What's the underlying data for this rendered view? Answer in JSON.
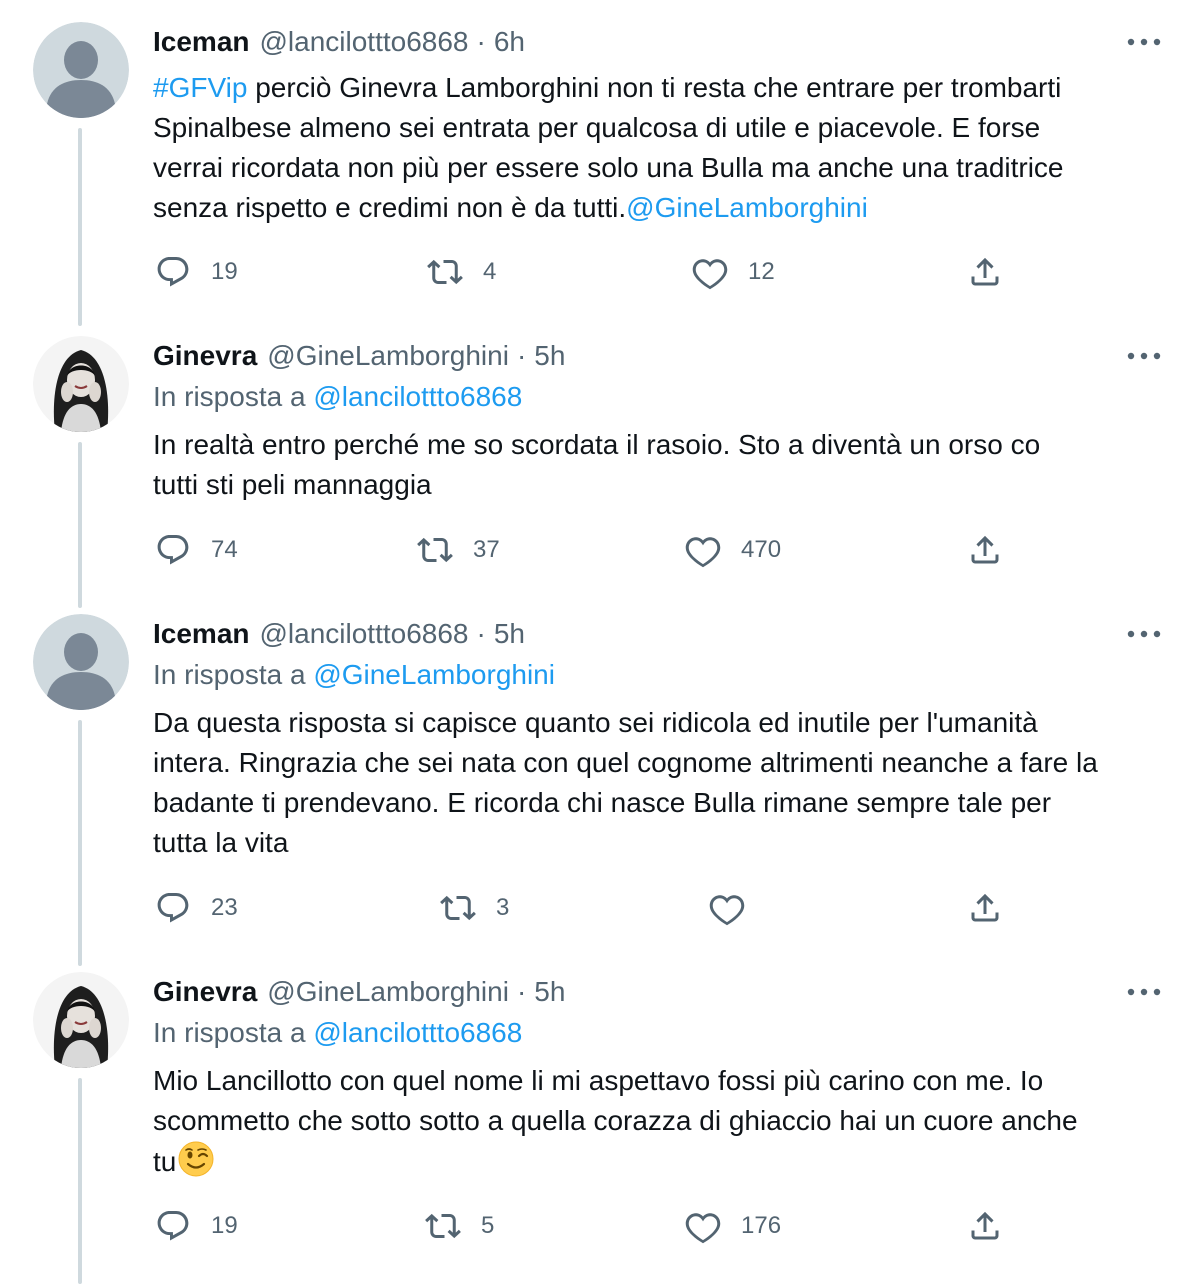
{
  "tweets": [
    {
      "avatar": "default-avatar",
      "name": "Iceman",
      "handle": "@lancilottto6868",
      "time": "6h",
      "reply_prefix": "",
      "reply_to": "",
      "hashtag": "#GFVip",
      "text_lines": [
        " perciò Ginevra Lamborghini non ti resta che entrare per trombarti",
        "Spinalbese almeno sei entrata per qualcosa di utile e piacevole. E forse",
        "verrai ricordata non più per essere solo una Bulla ma anche una traditrice",
        "senza rispetto e credimi non è da tutti."
      ],
      "mention": "@GineLamborghini",
      "replies": "19",
      "retweets": "4",
      "likes": "12"
    },
    {
      "avatar": "ginevra-avatar",
      "name": "Ginevra",
      "handle": "@GineLamborghini",
      "time": "5h",
      "reply_prefix": "In risposta a ",
      "reply_to": "@lancilottto6868",
      "text_lines": [
        "In realtà entro perché me so scordata il rasoio. Sto a diventà un orso co",
        "tutti sti peli mannaggia"
      ],
      "replies": "74",
      "retweets": "37",
      "likes": "470"
    },
    {
      "avatar": "default-avatar",
      "name": "Iceman",
      "handle": "@lancilottto6868",
      "time": "5h",
      "reply_prefix": "In risposta a ",
      "reply_to": "@GineLamborghini",
      "text_lines": [
        "Da questa risposta si capisce quanto sei ridicola ed inutile per l'umanità",
        "intera. Ringrazia che sei nata con quel cognome altrimenti neanche a fare la",
        "badante ti prendevano. E ricorda chi nasce Bulla rimane sempre tale per",
        "tutta la vita"
      ],
      "replies": "23",
      "retweets": "3",
      "likes": ""
    },
    {
      "avatar": "ginevra-avatar",
      "name": "Ginevra",
      "handle": "@GineLamborghini",
      "time": "5h",
      "reply_prefix": "In risposta a ",
      "reply_to": "@lancilottto6868",
      "text_lines": [
        "Mio Lancillotto con quel nome li mi aspettavo fossi più carino con me. Io",
        "scommetto che sotto sotto a quella corazza di ghiaccio hai un cuore anche",
        "tu"
      ],
      "emoji": "winking-face-emoji",
      "replies": "19",
      "retweets": "5",
      "likes": "176"
    }
  ],
  "colors": {
    "text": "#0f1419",
    "secondary": "#536471",
    "link": "#1d9bf0",
    "thread_line": "#cfd9de"
  }
}
